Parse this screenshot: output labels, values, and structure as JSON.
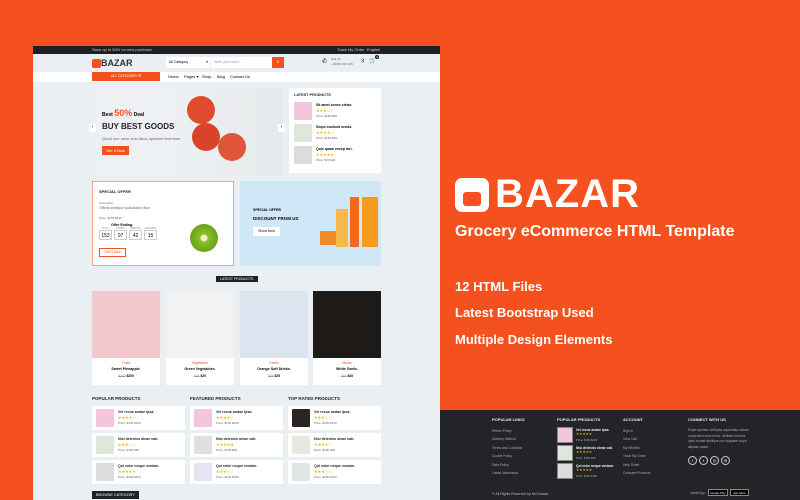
{
  "colors": {
    "accent": "#f4511e",
    "dark": "#1f2024",
    "background": "#e9eff2"
  },
  "topbar": {
    "promo": "Save up to 50% on new purchase.",
    "track": "Track My Order",
    "language": "English"
  },
  "header": {
    "logo": "BAZAR",
    "category_select": "All Category",
    "search_placeholder": "Write your need...",
    "call_label": "Call Us",
    "call_number": "+00052 324 326",
    "cart_count": "0"
  },
  "nav": {
    "all_category": "ALL CATEGORY",
    "items": [
      "Home",
      "Pages",
      "Shop",
      "Blog",
      "Contact Us"
    ]
  },
  "hero": {
    "pre": "Best",
    "discount": "50%",
    "post": "Deal",
    "title": "BUY BEST GOODS",
    "subtitle": "Quod iure nece solu tibus aperiam inventore",
    "button": "Get It Now"
  },
  "latest_sidebar": {
    "title": "LATEST PRODUCTS",
    "items": [
      {
        "name": "Sit amet conse ctetur.",
        "stars": "★★★☆☆",
        "price": "Price: $150 $80"
      },
      {
        "name": "Sequi incidunt sends.",
        "stars": "★★★★☆",
        "price": "Price: $150 $90"
      },
      {
        "name": "Quis quam excep turi.",
        "stars": "★★★★★",
        "price": "Price: $30 $20"
      }
    ]
  },
  "special_offer": {
    "title": "SPECIAL OFFER",
    "category": "Cosmetics",
    "desc": "Officiis similique quibusdam illum",
    "price": "Price: $150 $230",
    "ending": "Offer Ending:",
    "countdown": [
      {
        "label": "DAYS",
        "value": "153"
      },
      {
        "label": "HOURS",
        "value": "07"
      },
      {
        "label": "MINUTES",
        "value": "42"
      },
      {
        "label": "SECONDS",
        "value": "15"
      }
    ],
    "button": "Get It Now"
  },
  "banner": {
    "kicker": "SPECIAL OFFER",
    "title": "DISCOUNT FROM US",
    "button": "Show Now"
  },
  "latest_products": {
    "title": "LATEST PRODUCTS",
    "items": [
      {
        "category": "Fruits",
        "name": "Sweet Pineapple.",
        "old": "$300",
        "price": "$200"
      },
      {
        "category": "Vegetables",
        "name": "Green Vegetables.",
        "old": "$40",
        "price": "$20"
      },
      {
        "category": "Drinks",
        "name": "Orange Soft Drinks.",
        "old": "$35",
        "price": "$25"
      },
      {
        "category": "Meats",
        "name": "White Garlic.",
        "old": "$50",
        "price": "$45"
      }
    ]
  },
  "lists": [
    {
      "title": "POPULAR PRODUCTS",
      "items": [
        {
          "name": "Vel recus andae Ipsa.",
          "stars": "★★★★☆",
          "price": "Price: $150 $230"
        },
        {
          "name": "Nisi deleniss oleae cati.",
          "stars": "★★★☆☆",
          "price": "Price: $150 $90"
        },
        {
          "name": "Qui enim neque veniam.",
          "stars": "★★★★★",
          "price": "Price: $200 $150"
        }
      ]
    },
    {
      "title": "FEATURED PRODUCTS",
      "items": [
        {
          "name": "Vel recus andae Ipsa.",
          "stars": "★★★★☆",
          "price": "Price: $150 $230"
        },
        {
          "name": "Nisi deleniss oleae cati.",
          "stars": "★★★★★",
          "price": "Price: $150 $90"
        },
        {
          "name": "Qui enim neque veniam.",
          "stars": "★★★☆☆",
          "price": "Price: $200 $150"
        }
      ]
    },
    {
      "title": "TOP RATED PRODUCTS",
      "items": [
        {
          "name": "Vel recus andae Ipsa.",
          "stars": "★★★☆☆",
          "price": "Price: $150 $230"
        },
        {
          "name": "Nisi deleniss oleae cati.",
          "stars": "★★★★☆",
          "price": "Price: $150 $90"
        },
        {
          "name": "Qui enim neque veniam.",
          "stars": "★★★☆☆",
          "price": "Price: $200 $150"
        }
      ]
    }
  ],
  "browse": "BROWSE CATEGORY",
  "promo": {
    "brand": "BAZAR",
    "subtitle": "Grocery eCommerce HTML Template",
    "features": [
      "12 HTML Files",
      "Latest Bootstrap Used",
      "Multiple Design Elements"
    ]
  },
  "footer": {
    "links_title": "POPULAR LINKS",
    "links": [
      "Return Policy",
      "Delivery Method",
      "Terms and Condition",
      "Cookie Policy",
      "Data Policy",
      "Latest Information"
    ],
    "products_title": "POPULAR PRODUCTS",
    "products": [
      {
        "name": "Vel recus andae Ipsa.",
        "stars": "★★★★★",
        "price": "Price: $150 $230"
      },
      {
        "name": "Nisi deleniss oleae cati.",
        "stars": "★★★★★",
        "price": "Price: $150 $90"
      },
      {
        "name": "Qui enim neque veniam.",
        "stars": "★★★★★",
        "price": "Price: $200 $150"
      }
    ],
    "account_title": "ACCOUNT",
    "account": [
      "Sign In",
      "View Cart",
      "My Wishlist",
      "Track My Order",
      "Help Ticket",
      "Compare Products"
    ],
    "connect_title": "CONNECT WITH US",
    "connect_text": "Explic aperiam velit ipsa aspernatur ratione volupt atem sunt nemo. Veritatis incidunt optio volutat similique non magnam culpa aliquam quasi.",
    "social": [
      "facebook",
      "twitter",
      "instagram",
      "email"
    ],
    "copyright": "© All Rights Reserved by Md Dalwar",
    "install": "Install App:",
    "google_play": "Google Play",
    "app_store": "App Store"
  }
}
